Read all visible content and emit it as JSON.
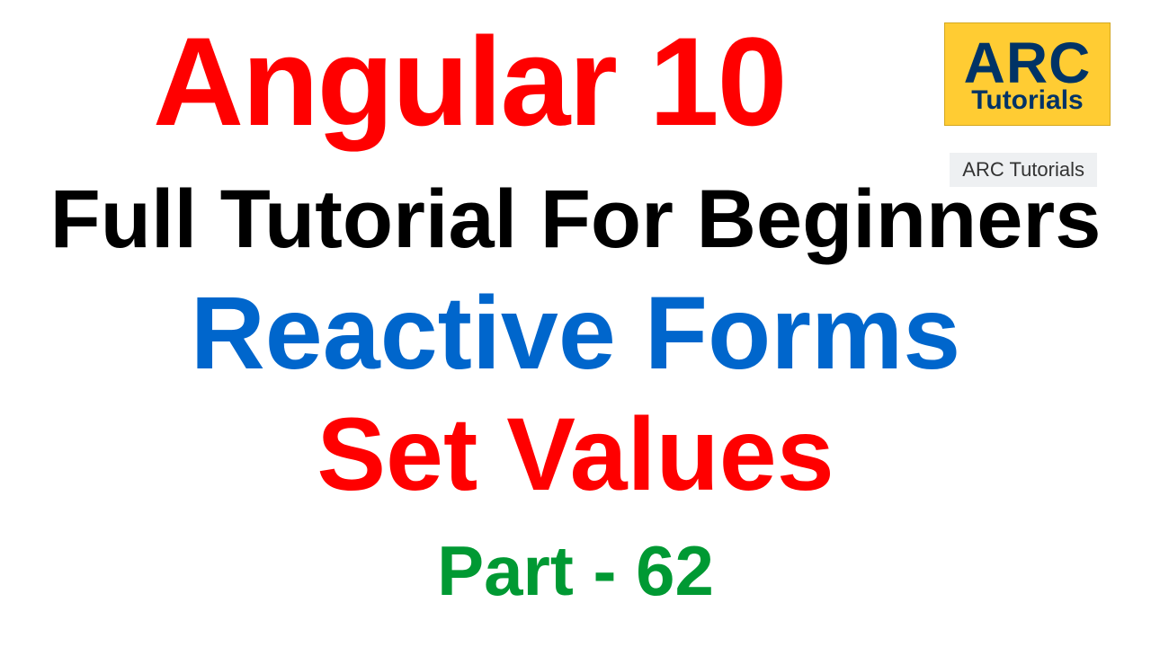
{
  "title_main": "Angular 10",
  "logo": {
    "line1": "ARC",
    "line2": "Tutorials"
  },
  "watermark": "ARC Tutorials",
  "subtitle": "Full Tutorial For Beginners",
  "topic1": "Reactive Forms",
  "topic2": "Set Values",
  "part": "Part - 62"
}
